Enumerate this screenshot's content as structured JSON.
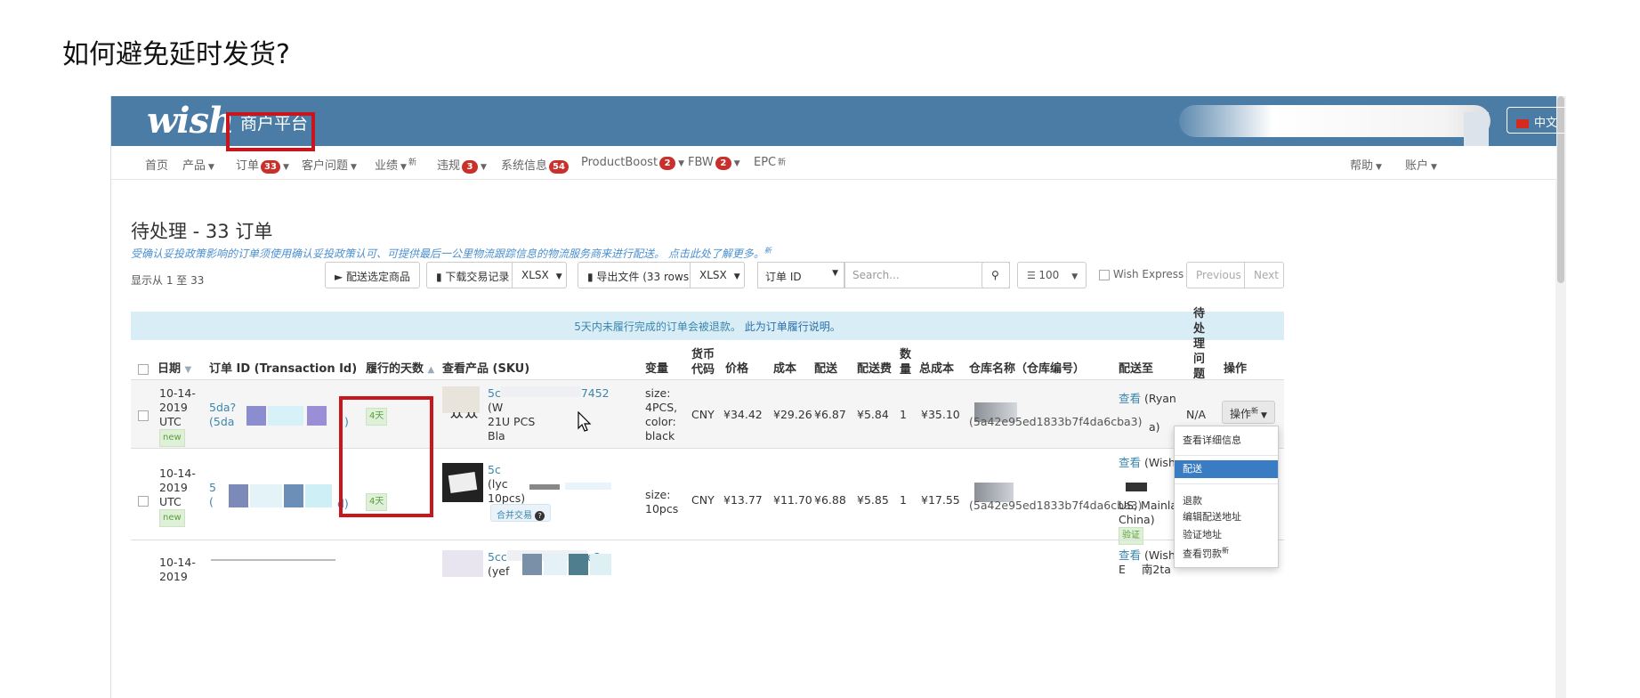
{
  "slide_title": "如何避免延时发货?",
  "header": {
    "logo": "wish",
    "logo_sub": "商户平台",
    "lang": "中文"
  },
  "nav": {
    "home": "首页",
    "products": "产品",
    "orders": "订单",
    "orders_badge": "33",
    "customer_issues": "客户问题",
    "performance": "业绩",
    "performance_new": "新",
    "violations": "违规",
    "violations_badge": "3",
    "system_info": "系统信息",
    "system_info_badge": "54",
    "productboost": "ProductBoost",
    "productboost_badge": "2",
    "fbw": "FBW",
    "fbw_badge": "2",
    "epc": "EPC",
    "epc_new": "新",
    "help": "帮助",
    "account": "账户"
  },
  "page": {
    "title": "待处理 - 33 订单",
    "notice": "受确认妥投政策影响的订单须使用确认妥投政策认可、可提供最后一公里物流跟踪信息的物流服务商来进行配送。 点击此处了解更多。",
    "notice_new": "新",
    "show_range": "显示从 1 至 33"
  },
  "toolbar": {
    "ship_selected": "配送选定商品",
    "download_tx": "下载交易记录",
    "download_fmt": "XLSX",
    "export": "导出文件 (33 rows)",
    "export_fmt": "XLSX",
    "filter_field": "订单 ID",
    "search_placeholder": "Search...",
    "page_size": "100",
    "wish_express": "Wish Express",
    "previous": "Previous",
    "next": "Next"
  },
  "alert": {
    "text": "5天内未履行完成的订单会被退款。",
    "link": "此为订单履行说明。"
  },
  "columns": {
    "date": "日期",
    "order_id": "订单 ID (Transaction Id)",
    "days": "履行的天数",
    "product": "查看产品 (SKU)",
    "variant": "变量",
    "currency_l1": "货币",
    "currency_l2": "代码",
    "price": "价格",
    "cost": "成本",
    "shipping": "配送",
    "shipping_fee": "配送费",
    "qty_l1": "数",
    "qty_l2": "量",
    "total_cost": "总成本",
    "warehouse": "仓库名称（仓库编号）",
    "ship_to": "配送至",
    "pending_l1": "待",
    "pending_l2": "处",
    "pending_l3": "理",
    "pending_l4": "问",
    "pending_l5": "题",
    "actions": "操作"
  },
  "rows": [
    {
      "date_l1": "10-14-",
      "date_l2": "2019",
      "date_l3": "UTC",
      "new": "new",
      "oid_l1": "5da?",
      "oid_l2": "(5da",
      "oid_tail": ")",
      "days": "4天",
      "sku_l1": "5c",
      "sku_tail": "7452",
      "sku_l2": "(W",
      "sku_l3": "21U",
      "sku_l3b": "PCS",
      "sku_l4": "Bla",
      "variant_l1": "size:",
      "variant_l2": "4PCS,",
      "variant_l3": "color:",
      "variant_l4": "black",
      "currency": "CNY",
      "price": "¥34.42",
      "cost": "¥29.26",
      "shipping": "¥6.87",
      "shipping_fee": "¥5.84",
      "qty": "1",
      "total": "¥35.10",
      "warehouse": "(5a42e95ed1833b7f4da6cba3)",
      "shipto_view": "查看",
      "shipto_name": "(Ryan",
      "shipto_tail": "a)",
      "pending": "N/A",
      "action_btn": "操作",
      "action_new": "新"
    },
    {
      "date_l1": "10-14-",
      "date_l2": "2019",
      "date_l3": "UTC",
      "new": "new",
      "oid_l1": "5",
      "oid_l2": "(",
      "oid_tail": "d)",
      "days": "4天",
      "sku_l1": "5c",
      "sku_l2": "(lyc",
      "sku_l3": "10pcs)",
      "merge_btn": "合并交易",
      "variant_l1": "size:",
      "variant_l2": "10pcs",
      "currency": "CNY",
      "price": "¥13.77",
      "cost": "¥11.70",
      "shipping": "¥6.88",
      "shipping_fee": "¥5.85",
      "qty": "1",
      "total": "¥17.55",
      "warehouse": "(5a42e95ed1833b7f4da6cba3)",
      "shipto_view": "查看",
      "shipto_name": "(Wish",
      "shipto_l3": "US, Mainla",
      "shipto_l4": "China)",
      "verify": "验证"
    },
    {
      "date_l1": "10-14-",
      "date_l2": "2019",
      "sku_l1": "5cc",
      "sku_tail": "e2",
      "sku_l2": "(yef",
      "shipto_view": "查看",
      "shipto_name": "(Wish",
      "shipto_l2": "E",
      "shipto_l2b": "南2ta"
    }
  ],
  "dropdown": {
    "details": "查看详细信息",
    "ship": "配送",
    "refund": "退款",
    "edit_address": "编辑配送地址",
    "verify_address": "验证地址",
    "view_penalty": "查看罚款",
    "penalty_new": "新"
  }
}
